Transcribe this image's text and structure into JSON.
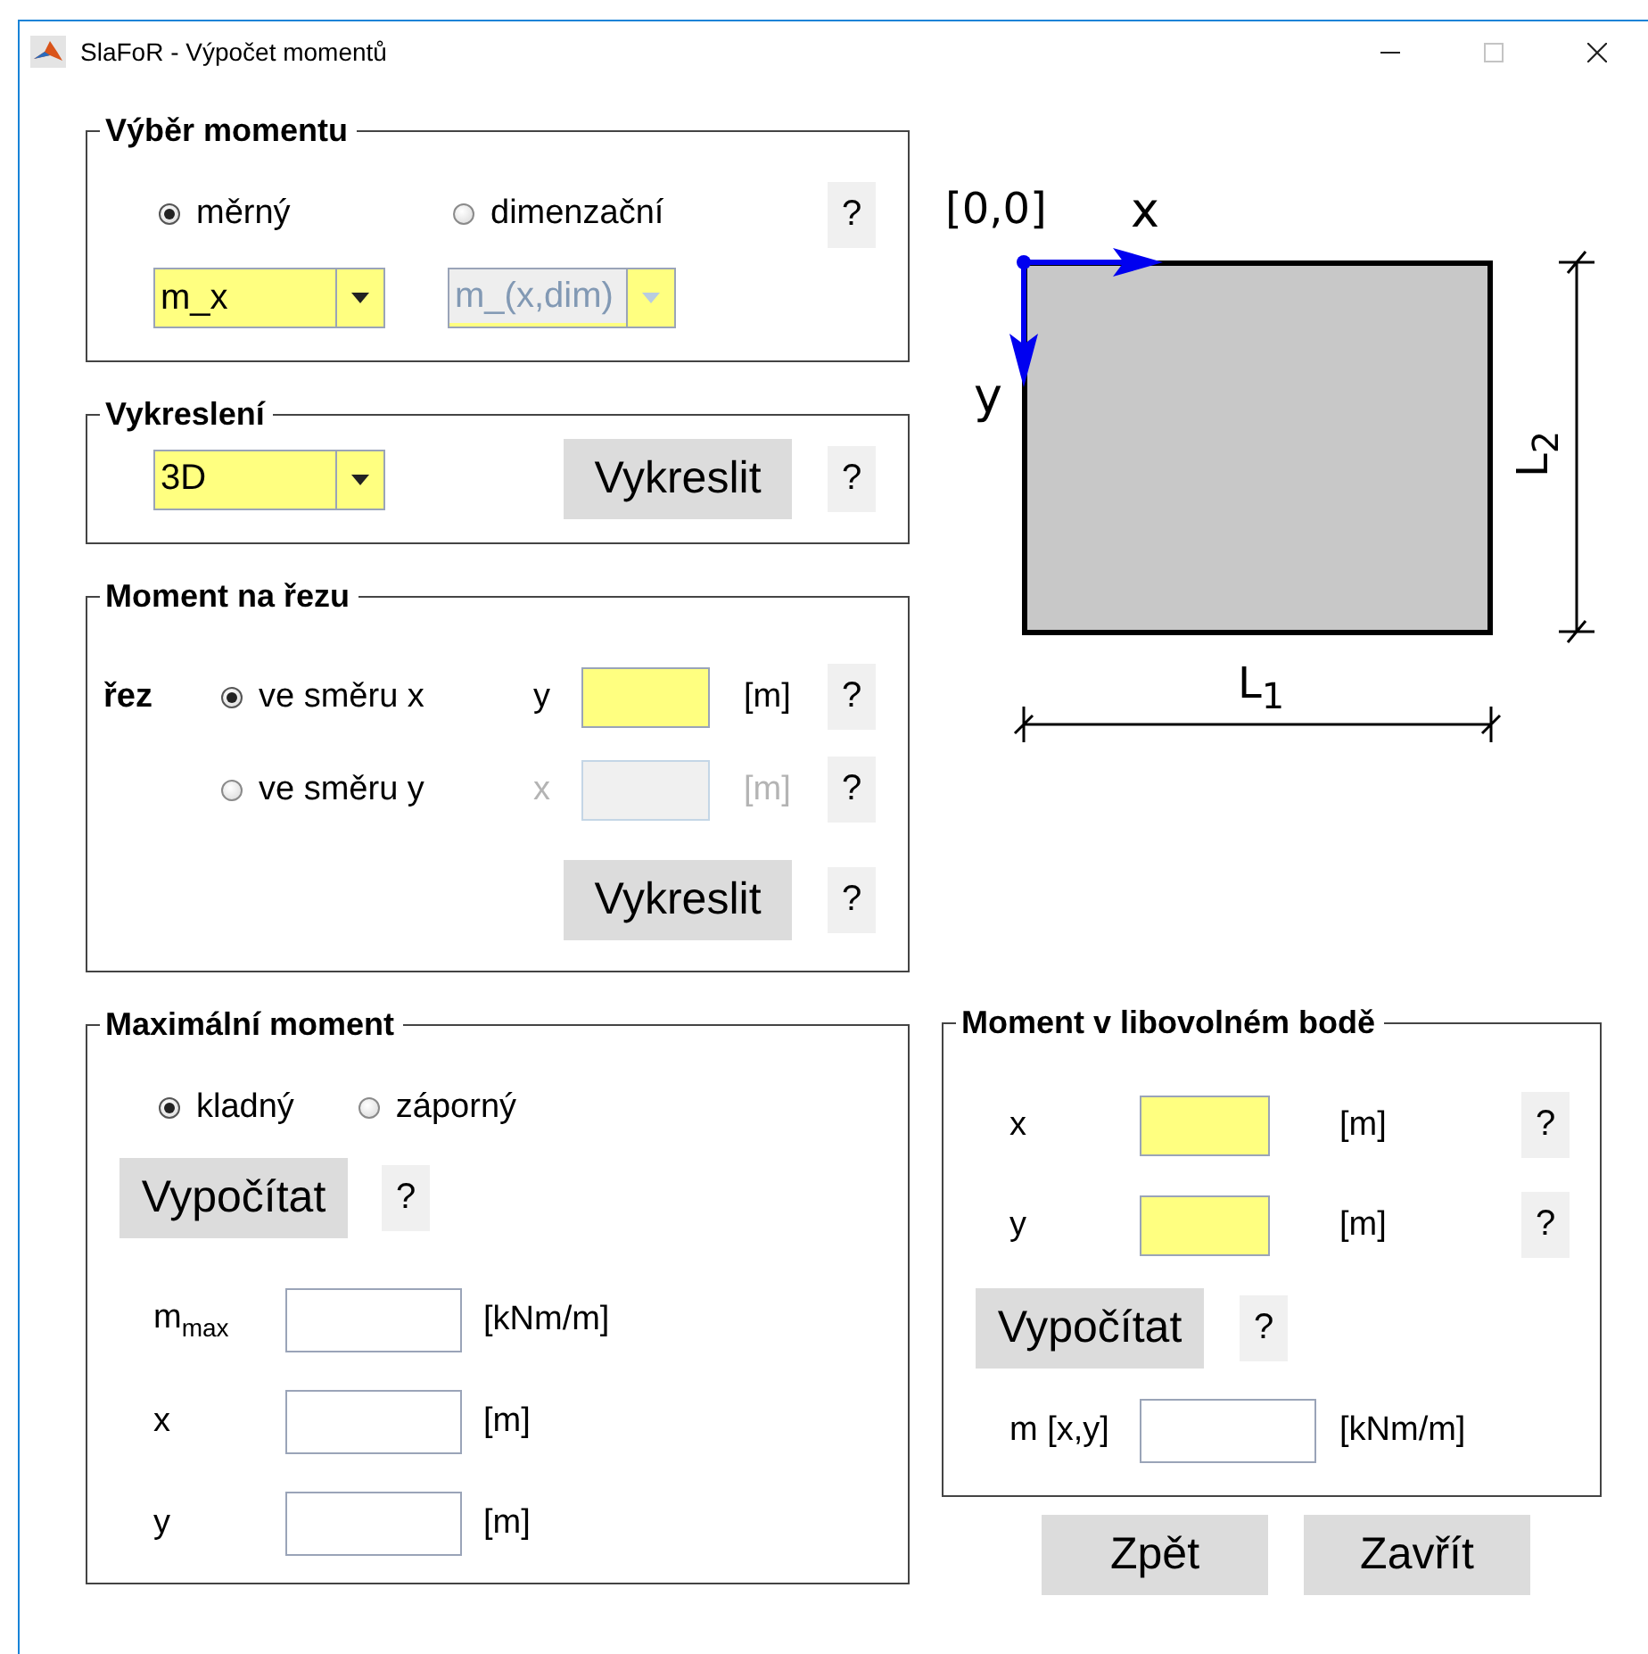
{
  "window": {
    "title": "SlaFoR - Výpočet momentů"
  },
  "moment_selection": {
    "title": "Výběr momentu",
    "options": [
      {
        "label": "měrný",
        "selected": true
      },
      {
        "label": "dimenzační",
        "selected": false
      }
    ],
    "dropdowns": [
      {
        "value": "m_x",
        "disabled": false
      },
      {
        "value": "m_(x,dim)",
        "disabled": true
      }
    ],
    "help": "?"
  },
  "plotting": {
    "title": "Vykreslení",
    "dropdown": {
      "value": "3D",
      "disabled": false
    },
    "button": "Vykreslit",
    "help": "?"
  },
  "section_moment": {
    "title": "Moment na řezu",
    "label": "řez",
    "rows": [
      {
        "option": "ve směru x",
        "selected": true,
        "coord": "y",
        "unit": "[m]",
        "disabled": false,
        "help": "?"
      },
      {
        "option": "ve směru y",
        "selected": false,
        "coord": "x",
        "unit": "[m]",
        "disabled": true,
        "help": "?"
      }
    ],
    "button": "Vykreslit",
    "help": "?"
  },
  "diagram": {
    "origin": "[0,0]",
    "x_axis": "x",
    "y_axis": "y",
    "l1": "L$_{1}$",
    "l2": "L$_{2}$"
  },
  "max_moment": {
    "title": "Maximální moment",
    "options": [
      {
        "label": "kladný",
        "selected": true
      },
      {
        "label": "záporný",
        "selected": false
      }
    ],
    "button": "Vypočítat",
    "help": "?",
    "results": [
      {
        "label": "m$_{max}$",
        "unit": "[kNm/m]"
      },
      {
        "label": "x",
        "unit": "[m]"
      },
      {
        "label": "y",
        "unit": "[m]"
      }
    ]
  },
  "point_moment": {
    "title": "Moment v libovolném bodě",
    "inputs": [
      {
        "label": "x",
        "unit": "[m]",
        "help": "?"
      },
      {
        "label": "y",
        "unit": "[m]",
        "help": "?"
      }
    ],
    "button": "Vypočítat",
    "help": "?",
    "result": {
      "label": "m [x,y]",
      "unit": "[kNm/m]"
    }
  },
  "buttons": [
    "Zpět",
    "Zavřít"
  ]
}
